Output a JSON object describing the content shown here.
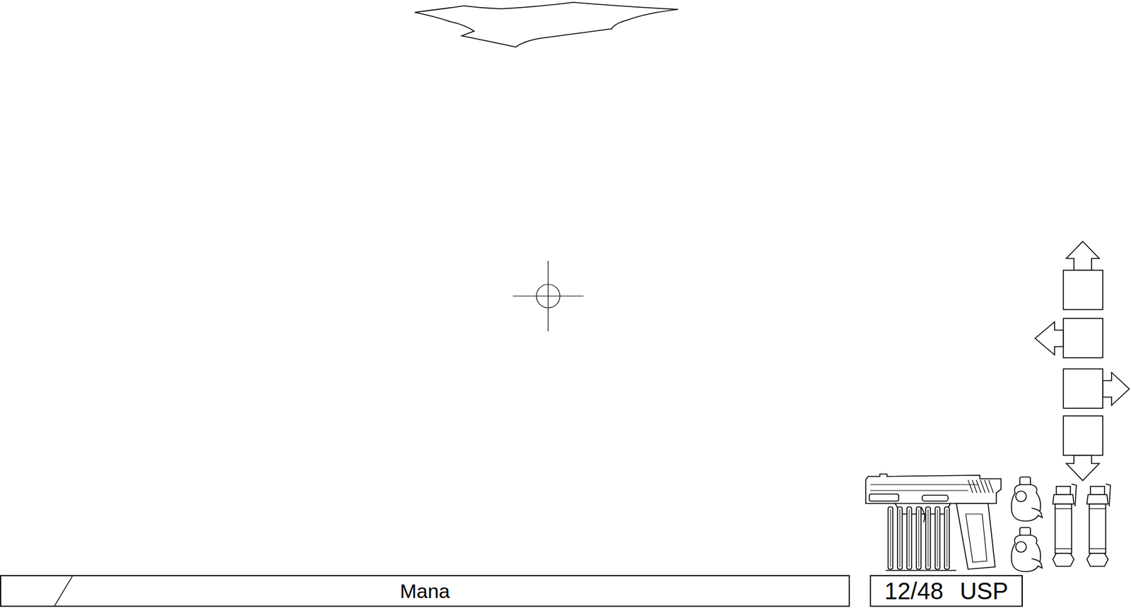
{
  "hud": {
    "mana": {
      "label": "Mana",
      "level": 0.074
    },
    "ammo": {
      "count": "12/48",
      "weapon": "USP"
    },
    "slots": [
      {
        "kind": "up"
      },
      {
        "kind": "left"
      },
      {
        "kind": "right"
      },
      {
        "kind": "down"
      }
    ],
    "grenades": [
      {
        "kind": "flashbang"
      },
      {
        "kind": "flashbang"
      },
      {
        "kind": "smoke"
      },
      {
        "kind": "smoke"
      }
    ]
  }
}
